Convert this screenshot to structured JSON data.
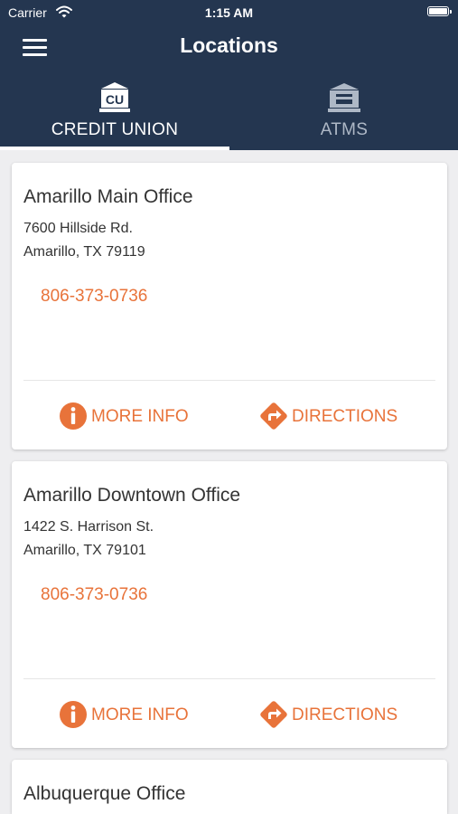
{
  "status_bar": {
    "carrier": "Carrier",
    "time": "1:15 AM"
  },
  "header": {
    "title": "Locations"
  },
  "tabs": [
    {
      "label": "CREDIT UNION",
      "active": true,
      "icon": "cu-bank-icon"
    },
    {
      "label": "ATMS",
      "active": false,
      "icon": "atm-icon"
    }
  ],
  "locations": [
    {
      "name": "Amarillo Main Office",
      "address_line1": "7600 Hillside Rd.",
      "address_line2": "Amarillo, TX 79119",
      "phone": "806-373-0736"
    },
    {
      "name": "Amarillo Downtown Office",
      "address_line1": "1422 S. Harrison St.",
      "address_line2": "Amarillo, TX 79101",
      "phone": "806-373-0736"
    },
    {
      "name": "Albuquerque Office"
    }
  ],
  "actions": {
    "more_info": "MORE INFO",
    "directions": "DIRECTIONS"
  },
  "colors": {
    "header_bg": "#243650",
    "accent": "#e8733a",
    "page_bg": "#eeeef0"
  }
}
